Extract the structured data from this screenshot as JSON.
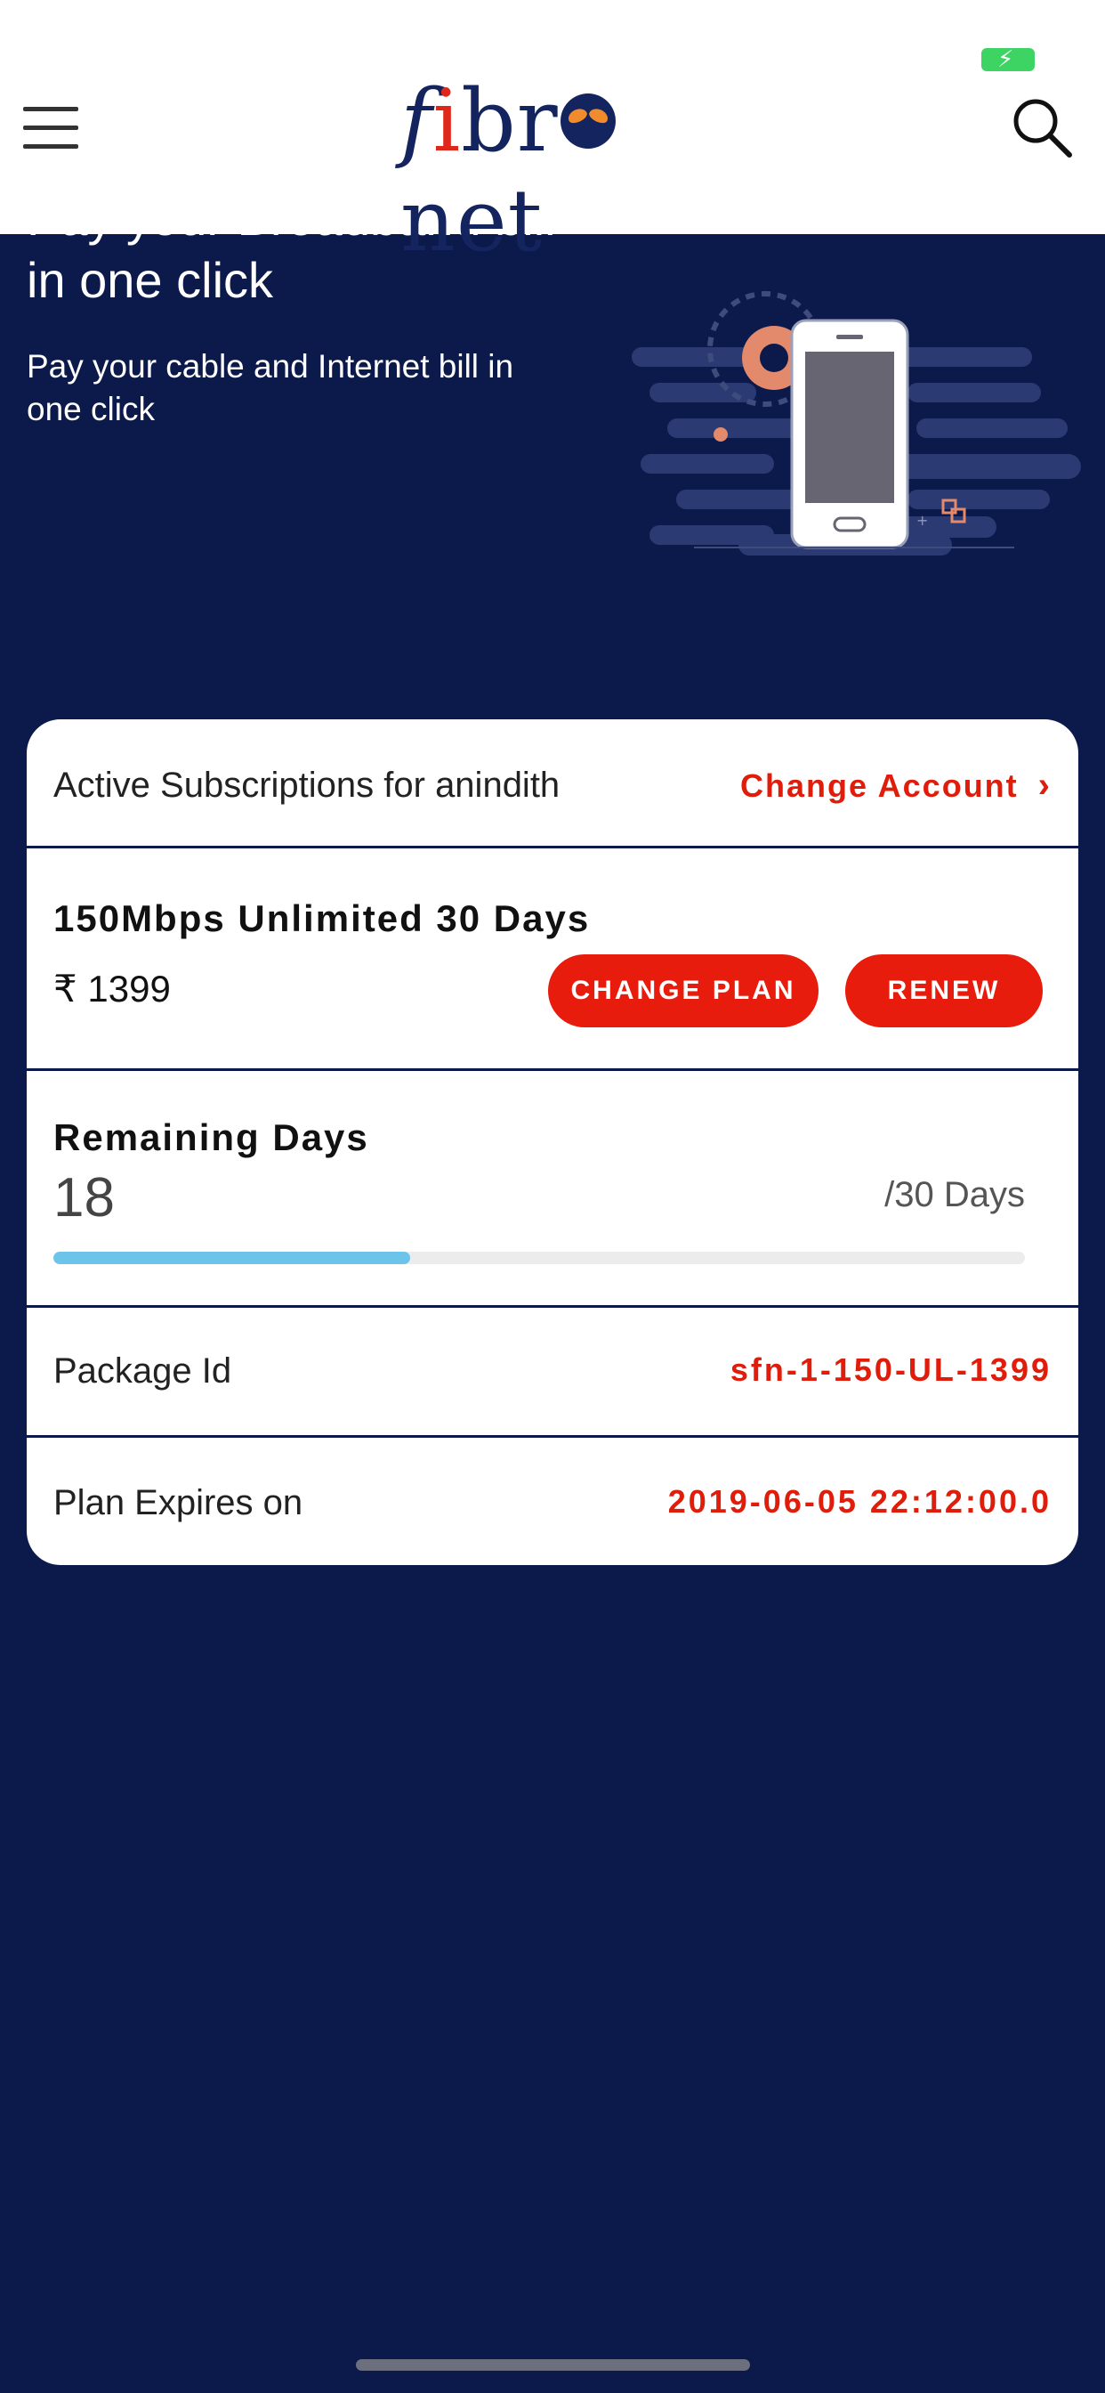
{
  "header": {
    "logo": {
      "f": "f",
      "i": "i",
      "br": "br",
      "net": "net"
    },
    "menu_icon": "hamburger-menu-icon",
    "search_icon": "search-icon",
    "battery_icon": "battery-charging-icon"
  },
  "hero": {
    "title": "Pay your Broadband bill in one click",
    "subtitle": "Pay your cable and Internet bill in one click",
    "illustration": "phone-gear-illustration"
  },
  "subscription": {
    "heading": "Active Subscriptions for anindith",
    "change_account": "Change Account",
    "plan_name": "150Mbps Unlimited 30 Days",
    "price": "₹ 1399",
    "change_plan_label": "CHANGE PLAN",
    "renew_label": "RENEW",
    "remaining_label": "Remaining Days",
    "remaining_days": "18",
    "total_days": "/30 Days",
    "progress_fraction": 0.367,
    "package_label": "Package Id",
    "package_id": "sfn-1-150-UL-1399",
    "expires_label": "Plan Expires on",
    "expires_value": "2019-06-05 22:12:00.0"
  },
  "colors": {
    "navy": "#0b1a4a",
    "accent_red": "#e81c0c",
    "progress_blue": "#6cc4ea",
    "battery_green": "#3dd464"
  }
}
